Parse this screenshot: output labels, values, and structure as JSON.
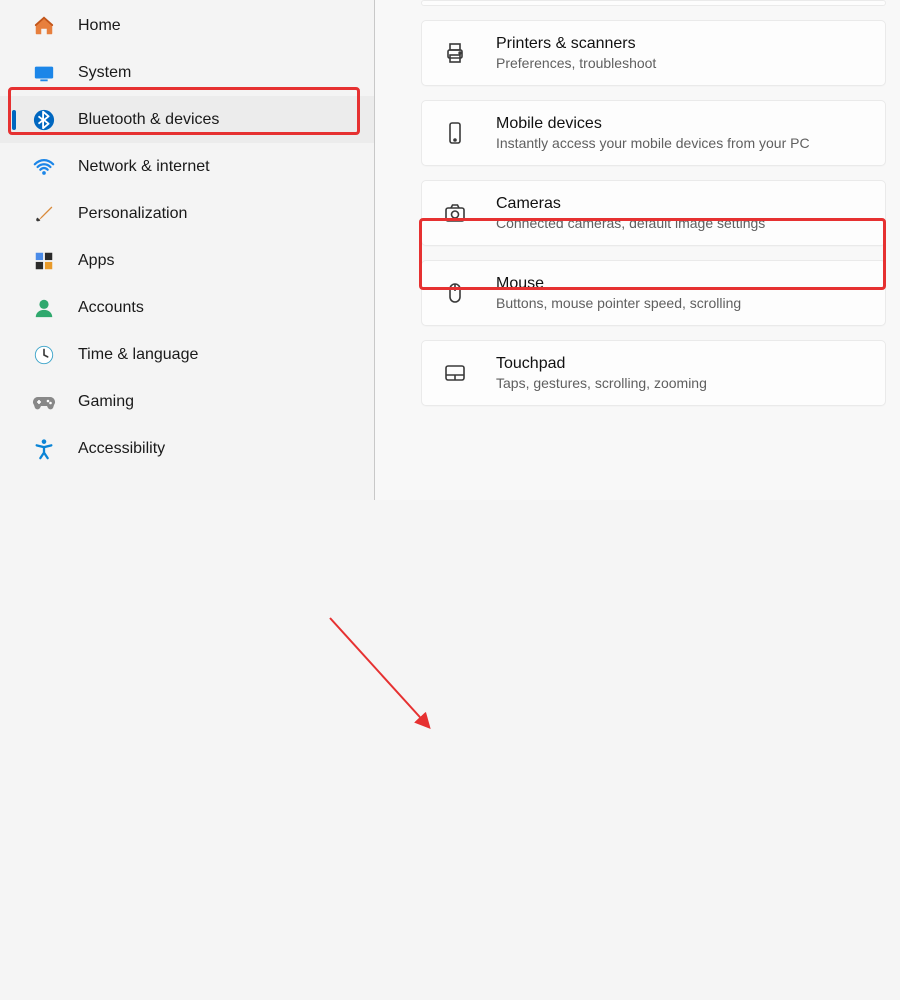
{
  "sidebar": {
    "items": [
      {
        "label": "Home",
        "icon": "home"
      },
      {
        "label": "System",
        "icon": "system"
      },
      {
        "label": "Bluetooth & devices",
        "icon": "bluetooth",
        "selected": true
      },
      {
        "label": "Network & internet",
        "icon": "wifi"
      },
      {
        "label": "Personalization",
        "icon": "brush"
      },
      {
        "label": "Apps",
        "icon": "apps"
      },
      {
        "label": "Accounts",
        "icon": "account"
      },
      {
        "label": "Time & language",
        "icon": "clock"
      },
      {
        "label": "Gaming",
        "icon": "gamepad"
      },
      {
        "label": "Accessibility",
        "icon": "accessibility"
      }
    ]
  },
  "main": {
    "cards": [
      {
        "title": "Printers & scanners",
        "subtitle": "Preferences, troubleshoot",
        "icon": "printer"
      },
      {
        "title": "Mobile devices",
        "subtitle": "Instantly access your mobile devices from your PC",
        "icon": "phone"
      },
      {
        "title": "Cameras",
        "subtitle": "Connected cameras, default image settings",
        "icon": "camera"
      },
      {
        "title": "Mouse",
        "subtitle": "Buttons, mouse pointer speed, scrolling",
        "icon": "mouse"
      },
      {
        "title": "Touchpad",
        "subtitle": "Taps, gestures, scrolling, zooming",
        "icon": "touchpad"
      }
    ]
  },
  "annotations": {
    "highlight_color": "#e63131",
    "arrow_from": "sidebar-item-bluetooth",
    "arrow_to": "card-cameras"
  }
}
